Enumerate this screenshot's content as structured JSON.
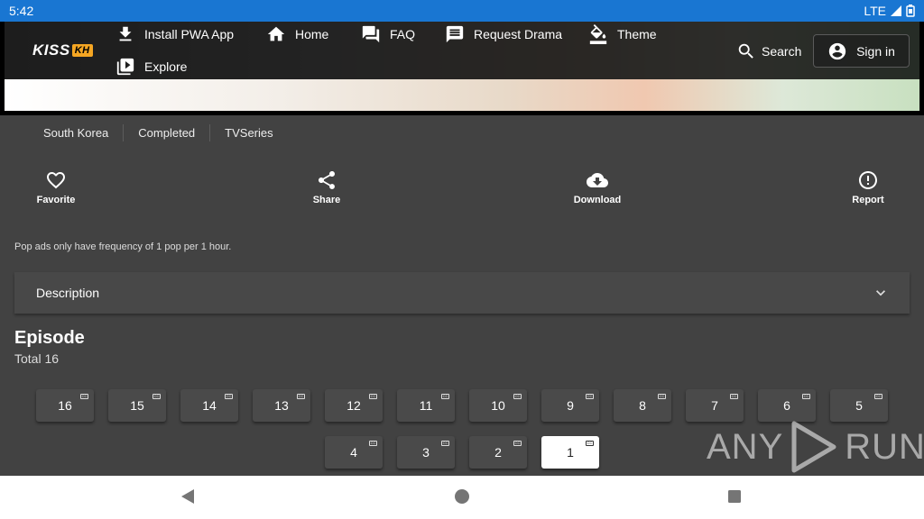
{
  "status_bar": {
    "time": "5:42",
    "network": "LTE"
  },
  "brand": {
    "logo_main": "KISS",
    "logo_suffix": "KH"
  },
  "nav": {
    "install": "Install PWA App",
    "home": "Home",
    "faq": "FAQ",
    "request": "Request Drama",
    "theme": "Theme",
    "explore": "Explore",
    "search": "Search",
    "sign_in": "Sign in"
  },
  "info_chips": [
    "South Korea",
    "Completed",
    "TVSeries"
  ],
  "actions": {
    "favorite": "Favorite",
    "share": "Share",
    "download": "Download",
    "report": "Report"
  },
  "notice": "Pop ads only have frequency of 1 pop per 1 hour.",
  "description": {
    "label": "Description"
  },
  "episodes": {
    "title": "Episode",
    "total": "Total 16",
    "row1": [
      "16",
      "15",
      "14",
      "13",
      "12",
      "11",
      "10",
      "9",
      "8",
      "7",
      "6",
      "5"
    ],
    "row2": [
      "4",
      "3",
      "2",
      "1"
    ],
    "selected": "1",
    "cc_label": "CC"
  },
  "watermark": {
    "left": "ANY",
    "right": "RUN"
  },
  "colors": {
    "status_bar": "#1976d2",
    "background": "#424242",
    "logo_accent": "#f5a623"
  }
}
